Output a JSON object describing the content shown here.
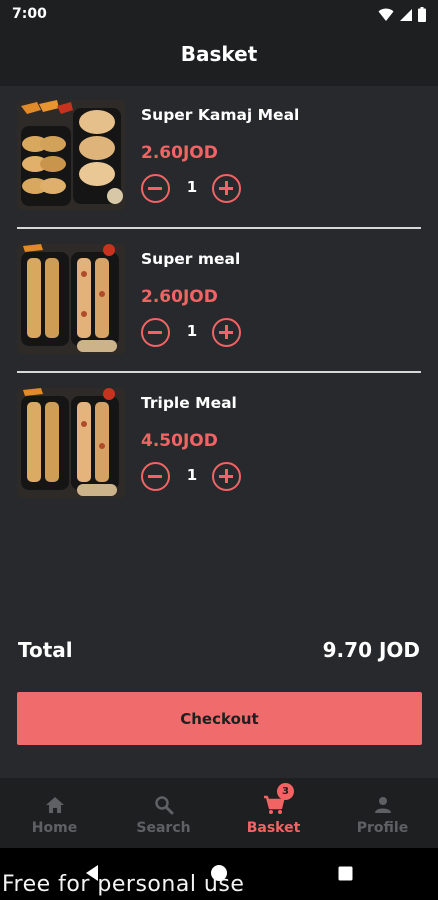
{
  "status": {
    "time": "7:00"
  },
  "header": {
    "title": "Basket"
  },
  "items": [
    {
      "name": "Super Kamaj Meal",
      "price": "2.60JOD",
      "qty": "1"
    },
    {
      "name": "Super meal",
      "price": "2.60JOD",
      "qty": "1"
    },
    {
      "name": "Triple Meal",
      "price": "4.50JOD",
      "qty": "1"
    }
  ],
  "total": {
    "label": "Total",
    "value": "9.70 JOD"
  },
  "checkout": {
    "label": "Checkout"
  },
  "nav": {
    "items": [
      {
        "label": "Home",
        "icon": "home-icon"
      },
      {
        "label": "Search",
        "icon": "search-icon"
      },
      {
        "label": "Basket",
        "icon": "cart-icon",
        "badge": "3",
        "active": true
      },
      {
        "label": "Profile",
        "icon": "person-icon"
      }
    ]
  },
  "watermark": "Free for personal use",
  "colors": {
    "accent": "#f26464",
    "background": "#28292c",
    "bar": "#1e1f21",
    "checkout": "#f06c6c"
  }
}
